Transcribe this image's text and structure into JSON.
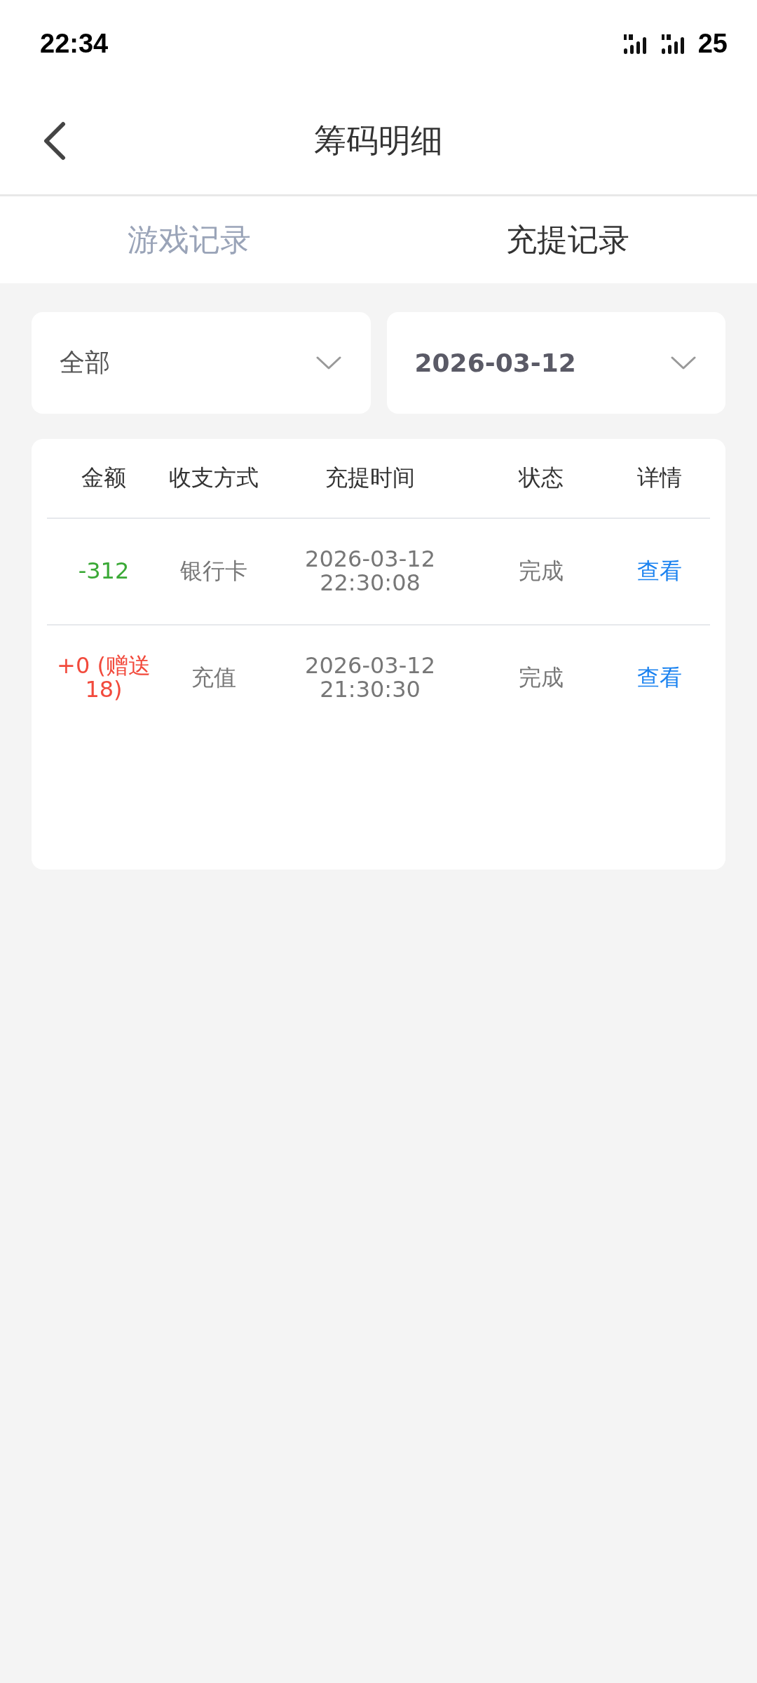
{
  "status_bar": {
    "time": "22:34",
    "battery": "25"
  },
  "header": {
    "title": "筹码明细"
  },
  "tabs": [
    {
      "label": "游戏记录",
      "selected": false
    },
    {
      "label": "充提记录",
      "selected": true
    }
  ],
  "filters": [
    {
      "value": "全部",
      "bold": false
    },
    {
      "value": "2026-03-12",
      "bold": true
    }
  ],
  "table": {
    "columns": [
      "金额",
      "收支方式",
      "充提时间",
      "状态",
      "详情"
    ],
    "rows": [
      {
        "amount": "-312",
        "kind": "expense",
        "method": "银行卡",
        "time": "2026-03-12 22:30:08",
        "status": "完成",
        "detail": "查看"
      },
      {
        "amount": "+0 (赠送18)",
        "kind": "income",
        "method": "充值",
        "time": "2026-03-12 21:30:30",
        "status": "完成",
        "detail": "查看"
      }
    ]
  }
}
